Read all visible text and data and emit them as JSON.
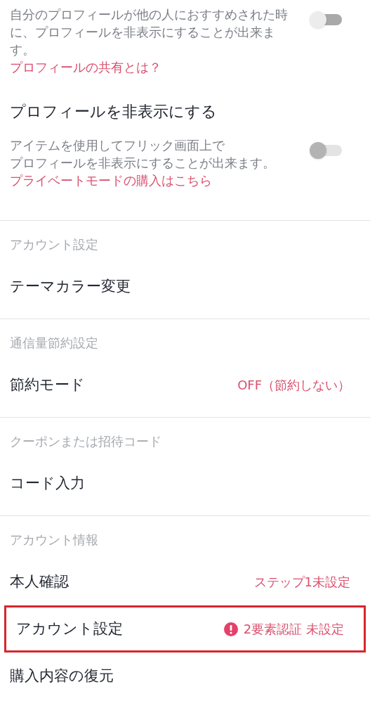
{
  "toggles": [
    {
      "description_lines": [
        "自分のプロフィールが他の人におすすめされた時",
        "に、プロフィールを非表示にすることが出来ま",
        "す。"
      ],
      "link": "プロフィールの共有とは？",
      "on": false,
      "disabled": false
    },
    {
      "title": "プロフィールを非表示にする",
      "description_lines": [
        "アイテムを使用してフリック画面上で",
        "プロフィールを非表示にすることが出来ます。"
      ],
      "link": "プライベートモードの購入はこちら",
      "on": false,
      "disabled": true
    }
  ],
  "sections": [
    {
      "header": "アカウント設定",
      "rows": [
        {
          "label": "テーマカラー変更"
        }
      ]
    },
    {
      "header": "通信量節約設定",
      "rows": [
        {
          "label": "節約モード",
          "value": "OFF（節約しない）"
        }
      ]
    },
    {
      "header": "クーポンまたは招待コード",
      "rows": [
        {
          "label": "コード入力"
        }
      ]
    },
    {
      "header": "アカウント情報",
      "rows": [
        {
          "label": "本人確認",
          "value": "ステップ1未設定"
        },
        {
          "label": "アカウント設定",
          "value": "2要素認証 未設定",
          "warning": true,
          "highlighted": true
        },
        {
          "label": "購入内容の復元"
        }
      ]
    }
  ]
}
